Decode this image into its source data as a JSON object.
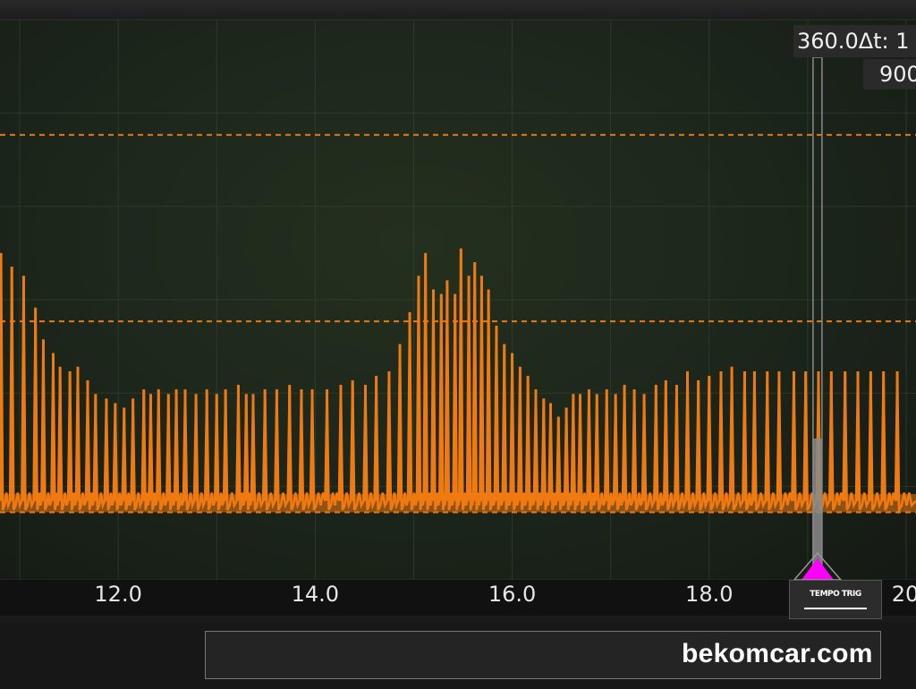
{
  "app": {
    "watermark": "bekomcar.com",
    "cursor": {
      "readout": "360.0Δt: 1",
      "level_label": "900",
      "x_value": 19.1,
      "tag_icon": "cursor-handle-icon",
      "tag_icon_text": "TEMPO TRIG"
    },
    "colors": {
      "trace": "#f07a12",
      "reference_line": "#e87a1a",
      "cursor_marker": "#ff00ff",
      "grid": "#3a4a38",
      "background": "#1e271c",
      "cursor_line": "#8a8a8a",
      "overview_marker": "#c8102e"
    }
  },
  "chart_data": {
    "type": "line",
    "x_tick_labels": [
      "12.0",
      "14.0",
      "16.0",
      "18.0",
      "20"
    ],
    "x_ticks": [
      12.0,
      14.0,
      16.0,
      18.0,
      20.0
    ],
    "xlim": [
      10.8,
      20.1
    ],
    "ylim": [
      0,
      1000
    ],
    "grid": true,
    "reference_lines": [
      {
        "y": 900,
        "style": "dashed"
      },
      {
        "y": 490,
        "style": "dashed"
      },
      {
        "y": 70,
        "style": "dashed"
      }
    ],
    "baseline_level": 95,
    "series": [
      {
        "color": "#f07a12",
        "pulse_x": [
          10.81,
          10.92,
          11.04,
          11.16,
          11.24,
          11.34,
          11.41,
          11.51,
          11.59,
          11.69,
          11.77,
          11.88,
          11.97,
          12.06,
          12.15,
          12.26,
          12.33,
          12.41,
          12.51,
          12.59,
          12.68,
          12.79,
          12.9,
          13.0,
          13.09,
          13.22,
          13.3,
          13.37,
          13.49,
          13.61,
          13.74,
          13.86,
          13.97,
          14.12,
          14.26,
          14.38,
          14.51,
          14.62,
          14.75,
          14.86,
          14.96,
          15.05,
          15.12,
          15.2,
          15.28,
          15.34,
          15.42,
          15.48,
          15.56,
          15.62,
          15.69,
          15.76,
          15.84,
          15.92,
          16.0,
          16.08,
          16.16,
          16.24,
          16.32,
          16.39,
          16.47,
          16.55,
          16.62,
          16.69,
          16.78,
          16.86,
          16.96,
          17.05,
          17.14,
          17.24,
          17.34,
          17.46,
          17.56,
          17.67,
          17.78,
          17.89,
          18.0,
          18.12,
          18.23,
          18.36,
          18.46,
          18.59,
          18.71,
          18.86,
          18.98,
          19.11,
          19.24,
          19.38,
          19.51,
          19.64,
          19.77,
          19.91
        ],
        "pulse_peaks": [
          640,
          610,
          590,
          520,
          450,
          420,
          390,
          380,
          390,
          360,
          330,
          320,
          310,
          300,
          320,
          340,
          330,
          340,
          330,
          340,
          340,
          330,
          340,
          330,
          340,
          350,
          330,
          330,
          340,
          340,
          350,
          340,
          340,
          340,
          350,
          360,
          350,
          370,
          380,
          440,
          510,
          590,
          640,
          560,
          550,
          580,
          550,
          650,
          590,
          620,
          590,
          560,
          480,
          440,
          420,
          390,
          370,
          340,
          320,
          310,
          280,
          300,
          330,
          330,
          340,
          330,
          340,
          330,
          350,
          340,
          330,
          350,
          360,
          350,
          380,
          360,
          370,
          380,
          390,
          380,
          380,
          380,
          380,
          380,
          380,
          380,
          380,
          380,
          380,
          380,
          380,
          380
        ]
      }
    ]
  }
}
